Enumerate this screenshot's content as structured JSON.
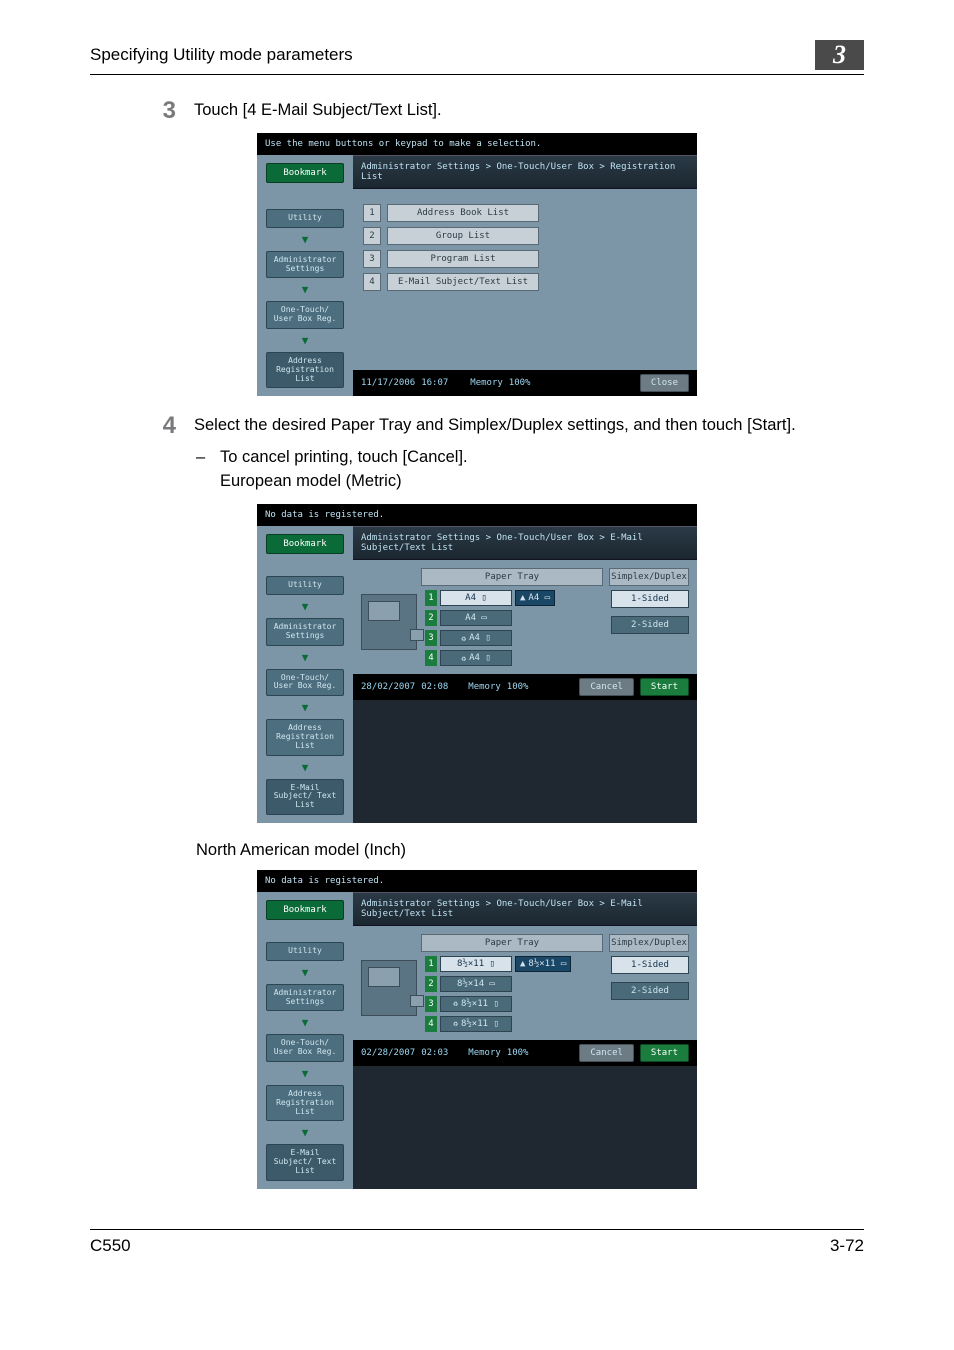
{
  "page": {
    "header": "Specifying Utility mode parameters",
    "chapter": "3",
    "footer_left": "C550",
    "footer_right": "3-72"
  },
  "steps": {
    "s3_num": "3",
    "s3_text": "Touch [4 E-Mail Subject/Text List].",
    "s4_num": "4",
    "s4_text": "Select the desired Paper Tray and Simplex/Duplex settings, and then touch [Start].",
    "s4_sub_dash": "–",
    "s4_sub_line1": "To cancel printing, touch [Cancel].",
    "s4_sub_line2": "European model (Metric)",
    "caption_na": "North American model (Inch)"
  },
  "ss1": {
    "top_msg": "Use the menu buttons or keypad to make a selection.",
    "bookmark": "Bookmark",
    "nav": {
      "utility": "Utility",
      "admin": "Administrator Settings",
      "onetouch": "One-Touch/\nUser Box Reg.",
      "addrreg": "Address\nRegistration\nList"
    },
    "breadcrumb": "Administrator Settings > One-Touch/User Box > Registration List",
    "menu": {
      "n1": "1",
      "l1": "Address Book List",
      "n2": "2",
      "l2": "Group List",
      "n3": "3",
      "l3": "Program List",
      "n4": "4",
      "l4": "E-Mail Subject/Text List"
    },
    "status_date": "11/17/2006",
    "status_time": "16:07",
    "status_mem_lbl": "Memory",
    "status_mem_val": "100%",
    "close": "Close"
  },
  "ss2": {
    "top_msg": "No data is registered.",
    "breadcrumb": "Administrator Settings > One-Touch/User Box > E-Mail Subject/Text List",
    "col_paper": "Paper Tray",
    "col_sd": "Simplex/Duplex",
    "trays": {
      "t1n": "1",
      "t1": "A4 ▯",
      "t2n": "2",
      "t2": "A4 ▭",
      "t3n": "3",
      "t3": "A4 ▯",
      "t4n": "4",
      "t4": "A4 ▯",
      "bypass": "A4 ▭"
    },
    "sd": {
      "one": "1-Sided",
      "two": "2-Sided"
    },
    "nav_extra": "E-Mail Subject/\nText List",
    "status_date": "28/02/2007",
    "status_time": "02:08",
    "status_mem_lbl": "Memory",
    "status_mem_val": "100%",
    "cancel": "Cancel",
    "start": "Start"
  },
  "ss3": {
    "top_msg": "No data is registered.",
    "breadcrumb": "Administrator Settings > One-Touch/User Box > E-Mail Subject/Text List",
    "col_paper": "Paper Tray",
    "col_sd": "Simplex/Duplex",
    "trays": {
      "t1n": "1",
      "t1": "8½×11 ▯",
      "t2n": "2",
      "t2": "8½×14 ▭",
      "t3n": "3",
      "t3": "8½×11 ▯",
      "t4n": "4",
      "t4": "8½×11 ▯",
      "bypass": "8½×11 ▭"
    },
    "sd": {
      "one": "1-Sided",
      "two": "2-Sided"
    },
    "status_date": "02/28/2007",
    "status_time": "02:03",
    "status_mem_lbl": "Memory",
    "status_mem_val": "100%",
    "cancel": "Cancel",
    "start": "Start"
  }
}
